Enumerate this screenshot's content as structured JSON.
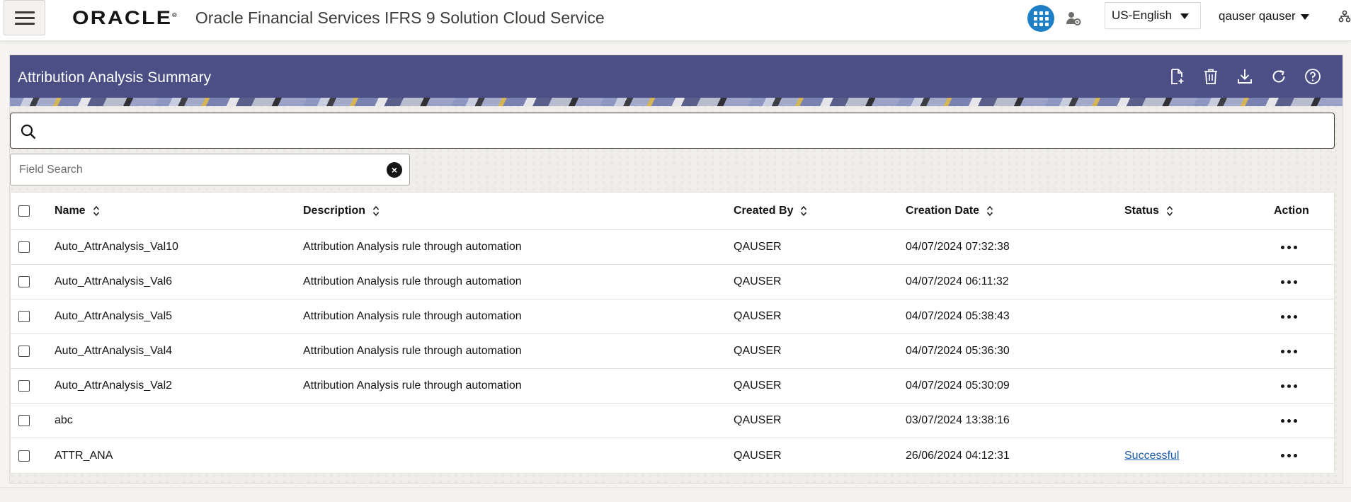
{
  "app": {
    "logo_text": "ORACLE",
    "logo_mark": "®",
    "title": "Oracle Financial Services IFRS 9 Solution Cloud Service",
    "language": "US-English",
    "user": "qauser qauser"
  },
  "icons": {
    "menu": "hamburger-menu-icon",
    "apps": "apps-grid-icon",
    "admin": "user-admin-icon",
    "org": "org-hierarchy-icon"
  },
  "panel": {
    "title": "Attribution Analysis Summary",
    "toolbar": [
      "new-document-icon",
      "delete-icon",
      "download-icon",
      "refresh-icon",
      "help-icon"
    ]
  },
  "search": {
    "placeholder": "",
    "field_search_placeholder": "Field Search"
  },
  "table": {
    "columns": {
      "name": "Name",
      "description": "Description",
      "created_by": "Created By",
      "creation_date": "Creation Date",
      "status": "Status",
      "action": "Action"
    },
    "rows": [
      {
        "name": "Auto_AttrAnalysis_Val10",
        "description": "Attribution Analysis rule through automation",
        "created_by": "QAUSER",
        "creation_date": "04/07/2024 07:32:38",
        "status": ""
      },
      {
        "name": "Auto_AttrAnalysis_Val6",
        "description": "Attribution Analysis rule through automation",
        "created_by": "QAUSER",
        "creation_date": "04/07/2024 06:11:32",
        "status": ""
      },
      {
        "name": "Auto_AttrAnalysis_Val5",
        "description": "Attribution Analysis rule through automation",
        "created_by": "QAUSER",
        "creation_date": "04/07/2024 05:38:43",
        "status": ""
      },
      {
        "name": "Auto_AttrAnalysis_Val4",
        "description": "Attribution Analysis rule through automation",
        "created_by": "QAUSER",
        "creation_date": "04/07/2024 05:36:30",
        "status": ""
      },
      {
        "name": "Auto_AttrAnalysis_Val2",
        "description": "Attribution Analysis rule through automation",
        "created_by": "QAUSER",
        "creation_date": "04/07/2024 05:30:09",
        "status": ""
      },
      {
        "name": "abc",
        "description": "",
        "created_by": "QAUSER",
        "creation_date": "03/07/2024 13:38:16",
        "status": ""
      },
      {
        "name": "ATTR_ANA",
        "description": "",
        "created_by": "QAUSER",
        "creation_date": "26/06/2024 04:12:31",
        "status": "Successful"
      }
    ]
  },
  "colors": {
    "header_band": "#4b4f86",
    "apps_button": "#1e7fc6",
    "link": "#1d5ea8"
  }
}
